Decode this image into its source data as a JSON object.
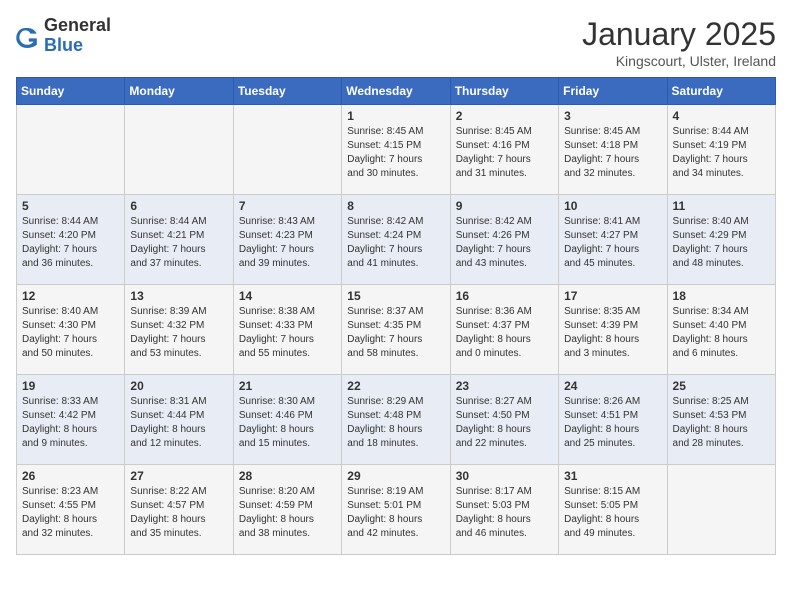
{
  "logo": {
    "general": "General",
    "blue": "Blue"
  },
  "header": {
    "month": "January 2025",
    "location": "Kingscourt, Ulster, Ireland"
  },
  "weekdays": [
    "Sunday",
    "Monday",
    "Tuesday",
    "Wednesday",
    "Thursday",
    "Friday",
    "Saturday"
  ],
  "weeks": [
    [
      {
        "day": "",
        "info": ""
      },
      {
        "day": "",
        "info": ""
      },
      {
        "day": "",
        "info": ""
      },
      {
        "day": "1",
        "info": "Sunrise: 8:45 AM\nSunset: 4:15 PM\nDaylight: 7 hours\nand 30 minutes."
      },
      {
        "day": "2",
        "info": "Sunrise: 8:45 AM\nSunset: 4:16 PM\nDaylight: 7 hours\nand 31 minutes."
      },
      {
        "day": "3",
        "info": "Sunrise: 8:45 AM\nSunset: 4:18 PM\nDaylight: 7 hours\nand 32 minutes."
      },
      {
        "day": "4",
        "info": "Sunrise: 8:44 AM\nSunset: 4:19 PM\nDaylight: 7 hours\nand 34 minutes."
      }
    ],
    [
      {
        "day": "5",
        "info": "Sunrise: 8:44 AM\nSunset: 4:20 PM\nDaylight: 7 hours\nand 36 minutes."
      },
      {
        "day": "6",
        "info": "Sunrise: 8:44 AM\nSunset: 4:21 PM\nDaylight: 7 hours\nand 37 minutes."
      },
      {
        "day": "7",
        "info": "Sunrise: 8:43 AM\nSunset: 4:23 PM\nDaylight: 7 hours\nand 39 minutes."
      },
      {
        "day": "8",
        "info": "Sunrise: 8:42 AM\nSunset: 4:24 PM\nDaylight: 7 hours\nand 41 minutes."
      },
      {
        "day": "9",
        "info": "Sunrise: 8:42 AM\nSunset: 4:26 PM\nDaylight: 7 hours\nand 43 minutes."
      },
      {
        "day": "10",
        "info": "Sunrise: 8:41 AM\nSunset: 4:27 PM\nDaylight: 7 hours\nand 45 minutes."
      },
      {
        "day": "11",
        "info": "Sunrise: 8:40 AM\nSunset: 4:29 PM\nDaylight: 7 hours\nand 48 minutes."
      }
    ],
    [
      {
        "day": "12",
        "info": "Sunrise: 8:40 AM\nSunset: 4:30 PM\nDaylight: 7 hours\nand 50 minutes."
      },
      {
        "day": "13",
        "info": "Sunrise: 8:39 AM\nSunset: 4:32 PM\nDaylight: 7 hours\nand 53 minutes."
      },
      {
        "day": "14",
        "info": "Sunrise: 8:38 AM\nSunset: 4:33 PM\nDaylight: 7 hours\nand 55 minutes."
      },
      {
        "day": "15",
        "info": "Sunrise: 8:37 AM\nSunset: 4:35 PM\nDaylight: 7 hours\nand 58 minutes."
      },
      {
        "day": "16",
        "info": "Sunrise: 8:36 AM\nSunset: 4:37 PM\nDaylight: 8 hours\nand 0 minutes."
      },
      {
        "day": "17",
        "info": "Sunrise: 8:35 AM\nSunset: 4:39 PM\nDaylight: 8 hours\nand 3 minutes."
      },
      {
        "day": "18",
        "info": "Sunrise: 8:34 AM\nSunset: 4:40 PM\nDaylight: 8 hours\nand 6 minutes."
      }
    ],
    [
      {
        "day": "19",
        "info": "Sunrise: 8:33 AM\nSunset: 4:42 PM\nDaylight: 8 hours\nand 9 minutes."
      },
      {
        "day": "20",
        "info": "Sunrise: 8:31 AM\nSunset: 4:44 PM\nDaylight: 8 hours\nand 12 minutes."
      },
      {
        "day": "21",
        "info": "Sunrise: 8:30 AM\nSunset: 4:46 PM\nDaylight: 8 hours\nand 15 minutes."
      },
      {
        "day": "22",
        "info": "Sunrise: 8:29 AM\nSunset: 4:48 PM\nDaylight: 8 hours\nand 18 minutes."
      },
      {
        "day": "23",
        "info": "Sunrise: 8:27 AM\nSunset: 4:50 PM\nDaylight: 8 hours\nand 22 minutes."
      },
      {
        "day": "24",
        "info": "Sunrise: 8:26 AM\nSunset: 4:51 PM\nDaylight: 8 hours\nand 25 minutes."
      },
      {
        "day": "25",
        "info": "Sunrise: 8:25 AM\nSunset: 4:53 PM\nDaylight: 8 hours\nand 28 minutes."
      }
    ],
    [
      {
        "day": "26",
        "info": "Sunrise: 8:23 AM\nSunset: 4:55 PM\nDaylight: 8 hours\nand 32 minutes."
      },
      {
        "day": "27",
        "info": "Sunrise: 8:22 AM\nSunset: 4:57 PM\nDaylight: 8 hours\nand 35 minutes."
      },
      {
        "day": "28",
        "info": "Sunrise: 8:20 AM\nSunset: 4:59 PM\nDaylight: 8 hours\nand 38 minutes."
      },
      {
        "day": "29",
        "info": "Sunrise: 8:19 AM\nSunset: 5:01 PM\nDaylight: 8 hours\nand 42 minutes."
      },
      {
        "day": "30",
        "info": "Sunrise: 8:17 AM\nSunset: 5:03 PM\nDaylight: 8 hours\nand 46 minutes."
      },
      {
        "day": "31",
        "info": "Sunrise: 8:15 AM\nSunset: 5:05 PM\nDaylight: 8 hours\nand 49 minutes."
      },
      {
        "day": "",
        "info": ""
      }
    ]
  ]
}
